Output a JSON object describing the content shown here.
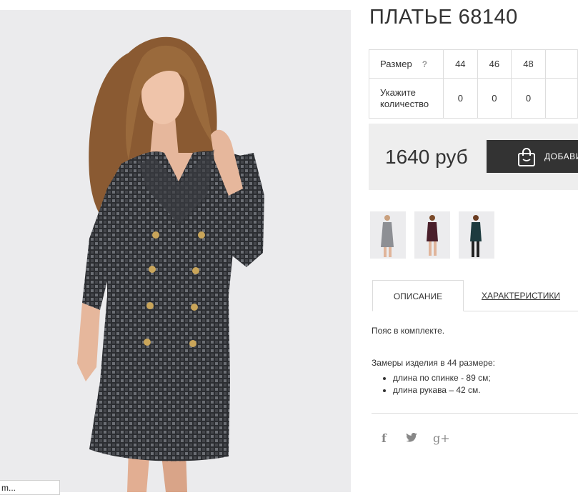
{
  "product": {
    "title": "ПЛАТЬЕ 68140"
  },
  "size_table": {
    "size_label": "Размер",
    "help_mark": "?",
    "sizes": [
      "44",
      "46",
      "48"
    ],
    "qty_label_line1": "Укажите",
    "qty_label_line2": "количество",
    "quantities": [
      "0",
      "0",
      "0"
    ]
  },
  "buy": {
    "price": "1640 руб",
    "cart_button": "ДОБАВИ"
  },
  "tabs": {
    "description": "ОПИСАНИЕ",
    "characteristics": "ХАРАКТЕРИСТИКИ"
  },
  "description": {
    "intro": "Пояс в комплекте.",
    "measure_title": "Замеры изделия в 44 размере:",
    "items": [
      "длина по спинке - 89 см;",
      "длина рукава – 42 см."
    ]
  },
  "social": {
    "facebook": "f",
    "google_plus": "g+"
  },
  "status_tip": "m...",
  "colors": {
    "dress_dark": "#2c2e33",
    "button_bg": "#333333",
    "buy_box_bg": "#eeeeee",
    "photo_bg": "#ebebed"
  }
}
